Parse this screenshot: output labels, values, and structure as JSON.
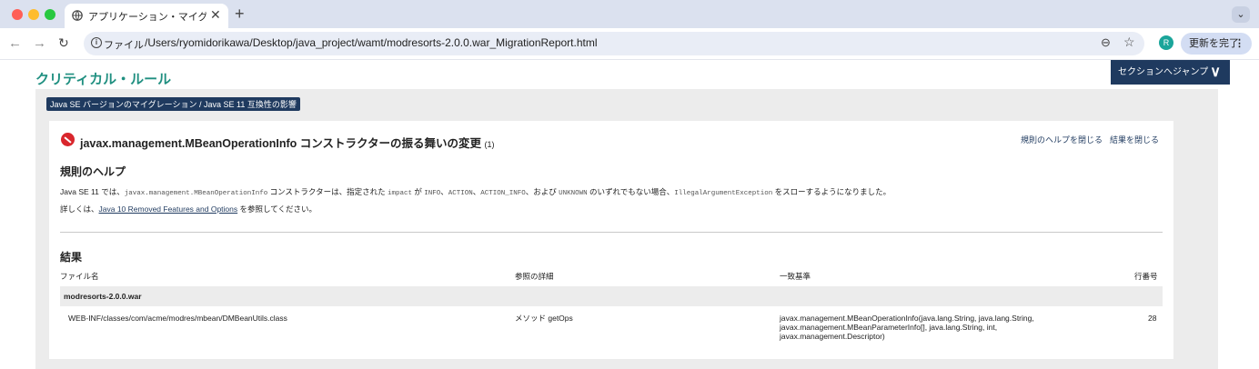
{
  "browser": {
    "tab_title": "アプリケーション・マイグレーシ",
    "tab_close": "✕",
    "new_tab": "+",
    "scheme_label": "ファイル",
    "url": "/Users/ryomidorikawa/Desktop/java_project/wamt/modresorts-2.0.0.war_MigrationReport.html",
    "avatar_letter": "R",
    "update_label": "更新を完了"
  },
  "page": {
    "section_title": "クリティカル・ルール",
    "jump_label": "セクションへジャンプ",
    "tag": "Java SE バージョンのマイグレーション / Java SE 11 互換性の影響",
    "rule": {
      "title": "javax.management.MBeanOperationInfo コンストラクターの振る舞いの変更",
      "count": "(1)",
      "close_help": "規則のヘルプを閉じる",
      "close_results": "結果を閉じる"
    },
    "help": {
      "heading": "規則のヘルプ",
      "line1": [
        {
          "t": "Java SE 11 では、",
          "m": false
        },
        {
          "t": "javax.management.MBeanOperationInfo",
          "m": true
        },
        {
          "t": " コンストラクターは、指定された ",
          "m": false
        },
        {
          "t": "impact",
          "m": true
        },
        {
          "t": " が ",
          "m": false
        },
        {
          "t": "INFO",
          "m": true
        },
        {
          "t": "、",
          "m": false
        },
        {
          "t": "ACTION",
          "m": true
        },
        {
          "t": "、",
          "m": false
        },
        {
          "t": "ACTION_INFO",
          "m": true
        },
        {
          "t": "、および ",
          "m": false
        },
        {
          "t": "UNKNOWN",
          "m": true
        },
        {
          "t": " のいずれでもない場合、",
          "m": false
        },
        {
          "t": "IllegalArgumentException",
          "m": true
        },
        {
          "t": " をスローするようになりました。",
          "m": false
        }
      ],
      "line2_prefix": "詳しくは、",
      "line2_link": "Java 10 Removed Features and Options",
      "line2_suffix": " を参照してください。"
    },
    "results": {
      "heading": "結果",
      "columns": [
        "ファイル名",
        "参照の詳細",
        "一致基準",
        "行番号"
      ],
      "group": "modresorts-2.0.0.war",
      "rows": [
        {
          "file": "WEB-INF/classes/com/acme/modres/mbean/DMBeanUtils.class",
          "detail": "メソッド getOps",
          "criteria": [
            "javax.management.MBeanOperationInfo(java.lang.String, java.lang.String,",
            "javax.management.MBeanParameterInfo[], java.lang.String, int,",
            "javax.management.Descriptor)"
          ],
          "line": "28"
        }
      ]
    }
  }
}
